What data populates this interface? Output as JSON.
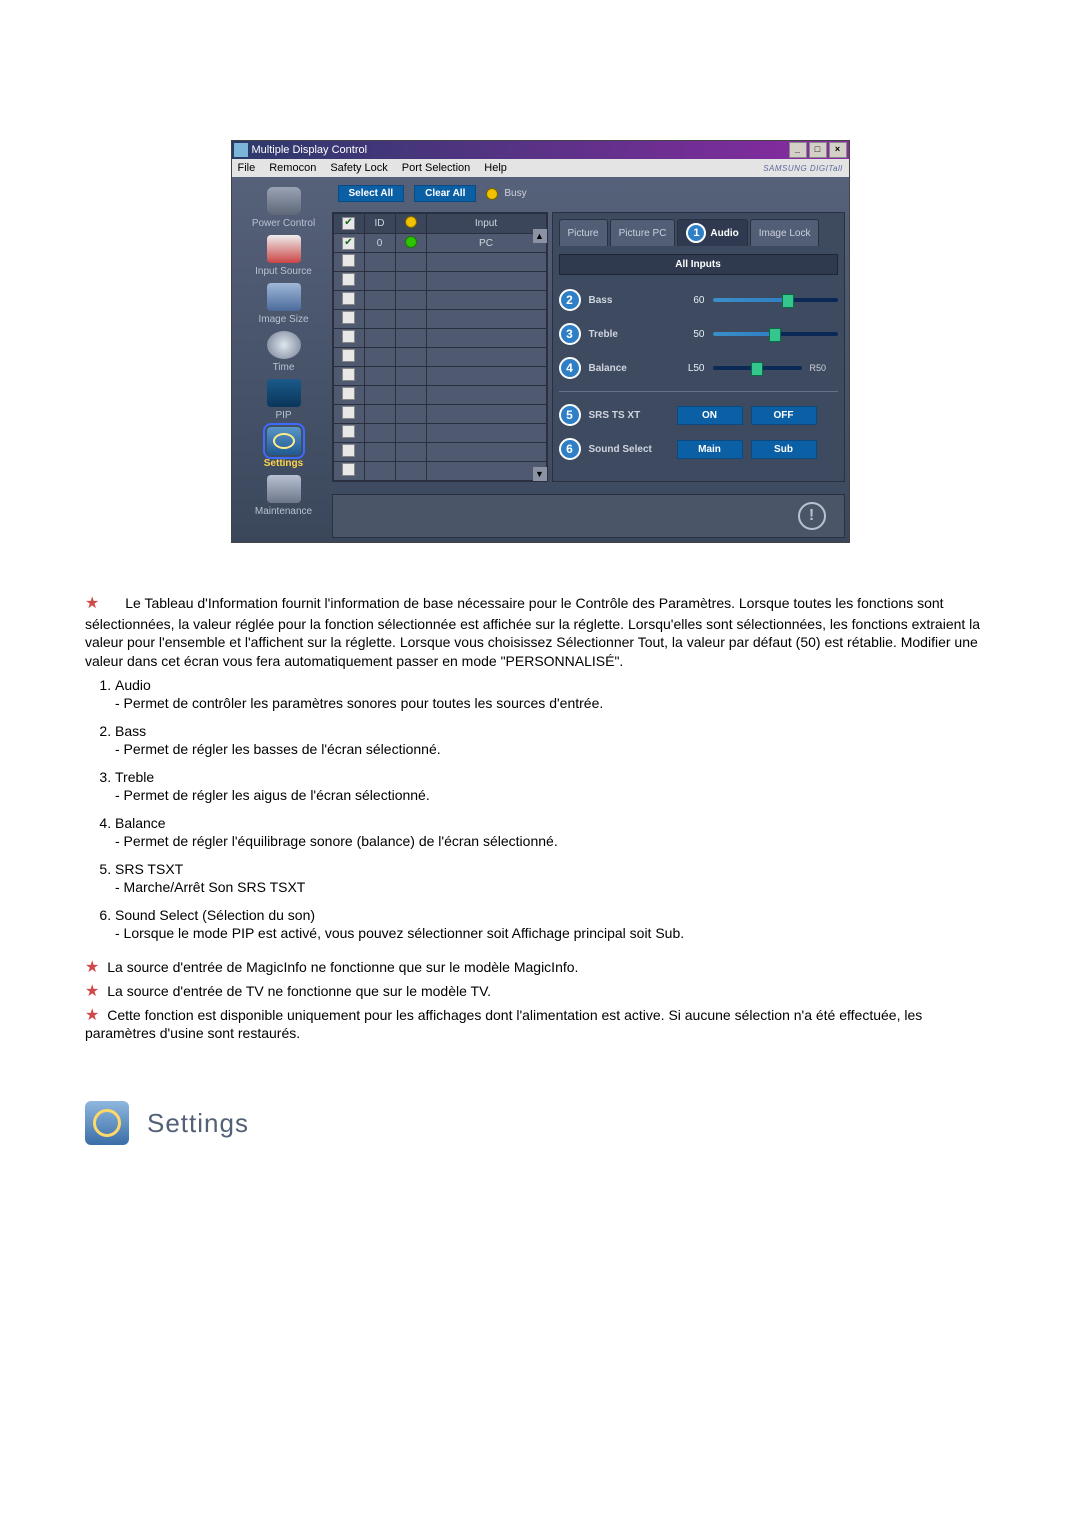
{
  "window": {
    "title": "Multiple Display Control",
    "brand": "SAMSUNG DIGITall"
  },
  "menu": {
    "items": [
      "File",
      "Remocon",
      "Safety Lock",
      "Port Selection",
      "Help"
    ]
  },
  "toolbar": {
    "select_all": "Select All",
    "clear_all": "Clear All",
    "busy": "Busy"
  },
  "sidebar": {
    "items": [
      {
        "label": "Power Control"
      },
      {
        "label": "Input Source"
      },
      {
        "label": "Image Size"
      },
      {
        "label": "Time"
      },
      {
        "label": "PIP"
      },
      {
        "label": "Settings"
      },
      {
        "label": "Maintenance"
      }
    ]
  },
  "table": {
    "headers": {
      "chk": "✔",
      "id": "ID",
      "status": "●",
      "input": "Input"
    },
    "row": {
      "id": "0",
      "input": "PC"
    }
  },
  "tabs": {
    "picture": "Picture",
    "picture_pc": "Picture PC",
    "audio": "Audio",
    "image_lock": "Image Lock",
    "callout_audio": "1"
  },
  "panel": {
    "strip": "All Inputs",
    "bass": {
      "label": "Bass",
      "value": "60",
      "callout": "2",
      "fill_pct": 60
    },
    "treble": {
      "label": "Treble",
      "value": "50",
      "callout": "3",
      "fill_pct": 50
    },
    "balance": {
      "label": "Balance",
      "left": "L50",
      "right": "R50",
      "callout": "4"
    },
    "srs": {
      "label": "SRS TS XT",
      "on": "ON",
      "off": "OFF",
      "callout": "5"
    },
    "sound_select": {
      "label": "Sound Select",
      "main": "Main",
      "sub": "Sub",
      "callout": "6"
    }
  },
  "notes": {
    "intro": "Le Tableau d'Information fournit l'information de base nécessaire pour le Contrôle des Paramètres. Lorsque toutes les fonctions sont sélectionnées, la valeur réglée pour la fonction sélectionnée est affichée sur la réglette. Lorsqu'elles sont sélectionnées, les fonctions extraient la valeur pour l'ensemble et l'affichent sur la réglette. Lorsque vous choisissez Sélectionner Tout, la valeur par défaut (50) est rétablie. Modifier une valeur dans cet écran vous fera automatiquement passer en mode \"PERSONNALISÉ\".",
    "list": [
      {
        "title": "Audio",
        "desc": "- Permet de contrôler les paramètres sonores pour toutes les sources d'entrée."
      },
      {
        "title": "Bass",
        "desc": "- Permet de régler les basses de l'écran sélectionné."
      },
      {
        "title": "Treble",
        "desc": "- Permet de régler les aigus de l'écran sélectionné."
      },
      {
        "title": "Balance",
        "desc": "- Permet de régler l'équilibrage sonore (balance) de l'écran sélectionné."
      },
      {
        "title": "SRS TSXT",
        "desc": "- Marche/Arrêt Son SRS TSXT"
      },
      {
        "title": "Sound Select (Sélection du son)",
        "desc": "- Lorsque le mode PIP est activé, vous pouvez sélectionner soit Affichage principal soit Sub."
      }
    ],
    "foot1": "La source d'entrée de MagicInfo ne fonctionne que sur le modèle MagicInfo.",
    "foot2": "La source d'entrée de TV ne fonctionne que sur le modèle TV.",
    "foot3": "Cette fonction est disponible uniquement pour les affichages dont l'alimentation est active. Si aucune sélection n'a été effectuée, les paramètres d'usine sont restaurés."
  },
  "section": {
    "title": "Settings"
  }
}
